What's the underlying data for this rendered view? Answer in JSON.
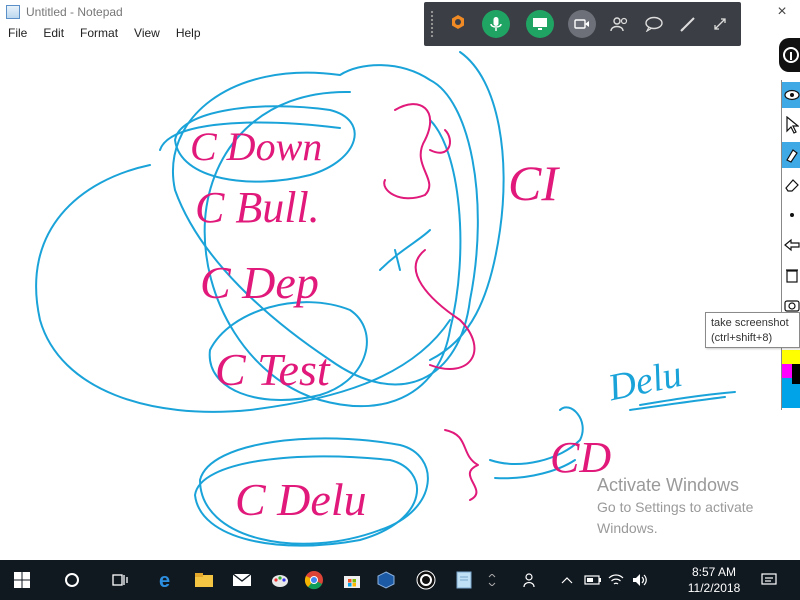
{
  "window": {
    "title": "Untitled - Notepad",
    "close_glyph": "×"
  },
  "menu": [
    "File",
    "Edit",
    "Format",
    "View",
    "Help"
  ],
  "annotation_toolbar": {
    "buttons": [
      "honeycomb-icon",
      "microphone-icon",
      "screen-share-icon",
      "camera-icon",
      "people-icon",
      "chat-bubble-icon",
      "pen-icon",
      "expand-icon"
    ],
    "colors": {
      "bg": "#3b3e44",
      "mic": "#1fa463",
      "share": "#1fa463",
      "camera": "#6d7078"
    }
  },
  "handwriting": {
    "ink_colors": {
      "blue": "#1aa3d9",
      "pink": "#e0197a"
    },
    "labels": [
      "C Down",
      "C Bull.",
      "C Dep",
      "C Test",
      "C Delu",
      "CI",
      "CD",
      "Delu"
    ]
  },
  "side_panel": {
    "tools": [
      "eye-icon",
      "cursor-icon",
      "highlighter-icon",
      "eraser-icon",
      "dot-icon",
      "undo-icon",
      "trash-icon",
      "camera-icon"
    ],
    "palette": [
      "#ffff00",
      "#ff00ff",
      "#000000",
      "#00a2e8"
    ]
  },
  "tooltip": {
    "line1": "take screenshot",
    "line2": "(ctrl+shift+8)"
  },
  "watermark": {
    "title": "Activate Windows",
    "line2": "Go to Settings to activate",
    "line3": "Windows."
  },
  "taskbar": {
    "apps": [
      "windows-start-icon",
      "cortana-icon",
      "task-view-icon",
      "edge-icon",
      "file-explorer-icon",
      "mail-icon",
      "paint-icon",
      "chrome-icon",
      "store-icon",
      "virtualbox-icon",
      "annotation-app-icon",
      "notepad-icon",
      "chevron-icon"
    ],
    "tray": [
      "people-icon",
      "up-arrow-icon",
      "battery-icon",
      "wifi-icon",
      "volume-icon"
    ],
    "time": "8:57 AM",
    "date": "11/2/2018"
  }
}
